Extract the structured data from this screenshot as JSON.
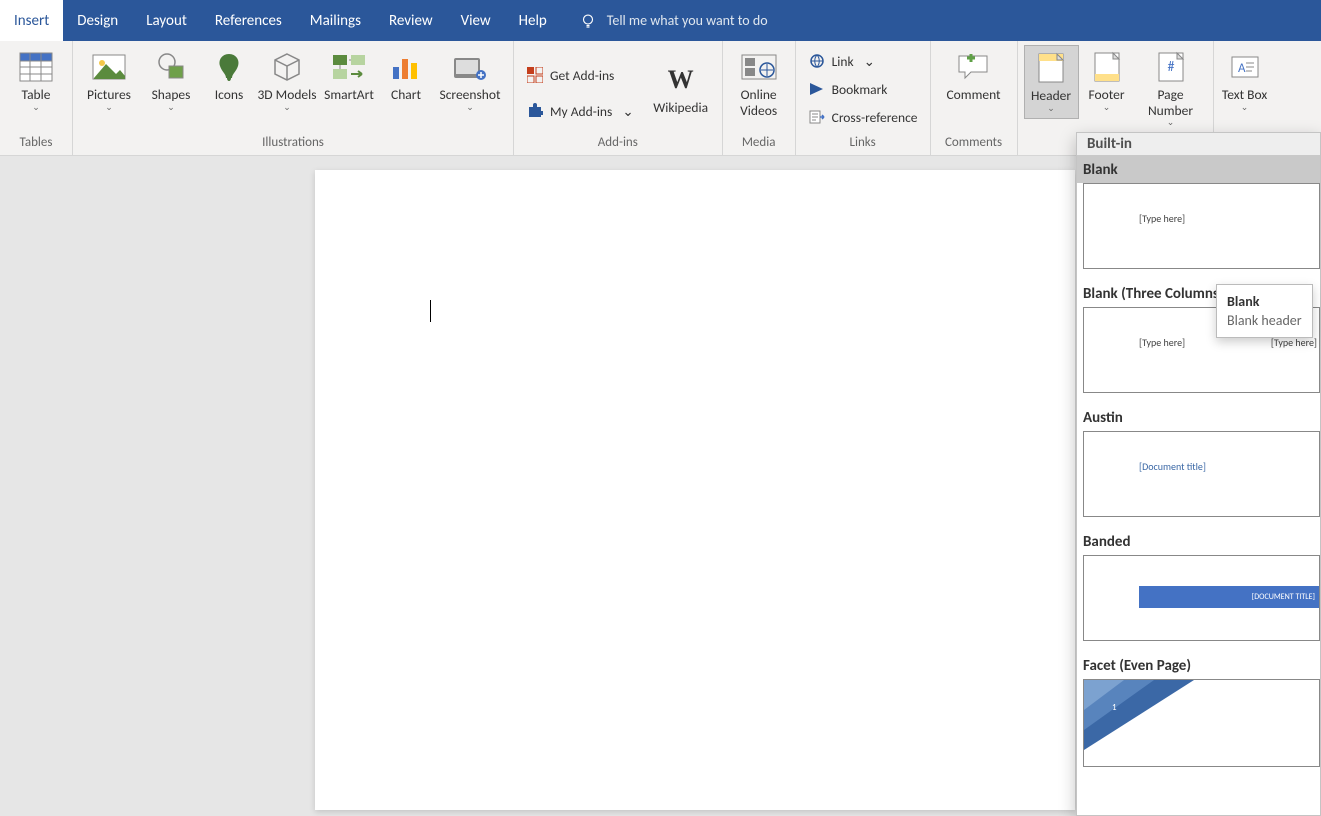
{
  "tabs": [
    "Insert",
    "Design",
    "Layout",
    "References",
    "Mailings",
    "Review",
    "View",
    "Help"
  ],
  "active_tab_index": 0,
  "tell_me": "Tell me what you want to do",
  "ribbon": {
    "tables": {
      "label": "Tables",
      "table": "Table"
    },
    "illustrations": {
      "label": "Illustrations",
      "pictures": "Pictures",
      "shapes": "Shapes",
      "icons": "Icons",
      "models": "3D Models",
      "smartart": "SmartArt",
      "chart": "Chart",
      "screenshot": "Screenshot"
    },
    "addins": {
      "label": "Add-ins",
      "get": "Get Add-ins",
      "my": "My Add-ins",
      "wikipedia": "Wikipedia"
    },
    "media": {
      "label": "Media",
      "videos": "Online Videos"
    },
    "links": {
      "label": "Links",
      "link": "Link",
      "bookmark": "Bookmark",
      "crossref": "Cross-reference"
    },
    "comments": {
      "label": "Comments",
      "comment": "Comment"
    },
    "header_footer": {
      "header": "Header",
      "footer": "Footer",
      "pagenum": "Page Number"
    },
    "text": {
      "textbox": "Text Box"
    }
  },
  "gallery": {
    "section": "Built-in",
    "items": [
      {
        "name": "Blank",
        "placeholders": [
          "[Type here]"
        ]
      },
      {
        "name": "Blank (Three Columns)",
        "placeholders": [
          "[Type here]",
          "[Type here]"
        ]
      },
      {
        "name": "Austin",
        "placeholders": [
          "[Document title]"
        ]
      },
      {
        "name": "Banded",
        "placeholders": [
          "[DOCUMENT TITLE]"
        ]
      },
      {
        "name": "Facet (Even Page)",
        "page_number": "1"
      }
    ]
  },
  "tooltip": {
    "title": "Blank",
    "desc": "Blank header"
  }
}
